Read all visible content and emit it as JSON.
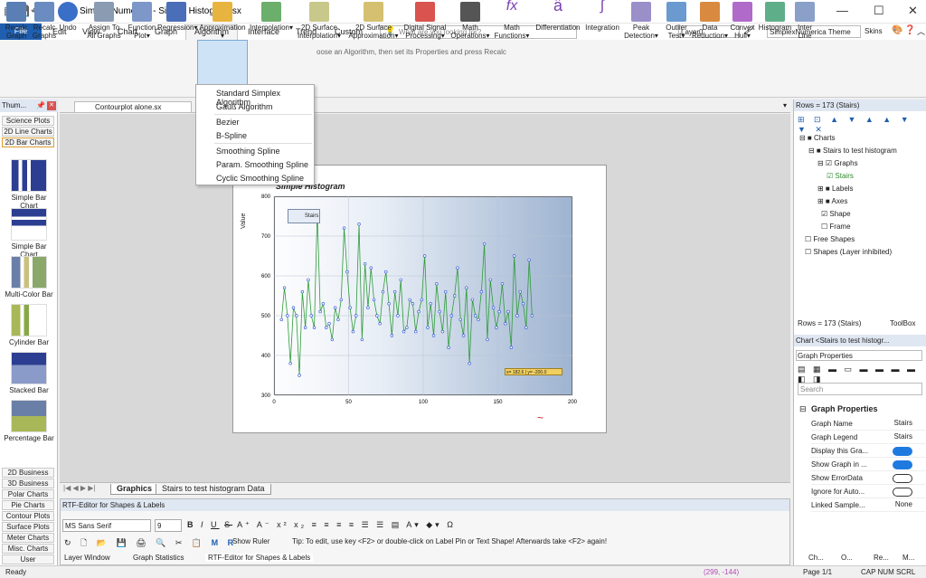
{
  "window": {
    "title": "SimplexNumerica - Simple Histogram.sx"
  },
  "ribbon_tabs": [
    "File",
    "Edit",
    "View",
    "Chart",
    "Graph",
    "Algorithm",
    "Interface",
    "Trend",
    "Custom"
  ],
  "search": {
    "placeholder": "What are you looking for?"
  },
  "layer": {
    "value": "Layer0"
  },
  "theme": {
    "value": "SimplexNumerica Theme",
    "skins_label": "Skins"
  },
  "ribbon_buttons": [
    {
      "label": "Recalc Graph"
    },
    {
      "label": "Recalc Graphs"
    },
    {
      "label": "Undo"
    },
    {
      "label": "Assign To All Graphs"
    },
    {
      "label": "Function Plot▾"
    },
    {
      "label": "Regression▾"
    },
    {
      "label": "Approximation"
    },
    {
      "label": "Interpolation▾"
    },
    {
      "label": "2D Surface Interpolation▾"
    },
    {
      "label": "2D Surface Approximation▾"
    },
    {
      "label": "Digital Signal Processing▾"
    },
    {
      "label": "Math Operations▾"
    },
    {
      "label": "Math Functions▾"
    },
    {
      "label": "Differentiation"
    },
    {
      "label": "Integration"
    },
    {
      "label": "Peak Detection▾"
    },
    {
      "label": "Outlier Test▾"
    },
    {
      "label": "Data Reduction▾"
    },
    {
      "label": "Convex Hull▾"
    },
    {
      "label": "Histogram"
    },
    {
      "label": "Inter Line"
    }
  ],
  "ribbon_hint": "oose an Algorithm, then set its Properties and press Recalc",
  "approx_menu": {
    "items": [
      "Standard Simplex Algorithm",
      "Gauß Algorithm",
      "Bezier",
      "B-Spline",
      "Smoothing Spline",
      "Param. Smoothing Spline",
      "Cyclic Smoothing Spline"
    ]
  },
  "doc_tab": {
    "label": "Contourplot alone.sx"
  },
  "left_panel": {
    "title": "Thum...",
    "categories_top": [
      "Science Plots",
      "2D Line Charts",
      "2D Bar Charts"
    ],
    "thumbs": [
      "Simple Bar Chart",
      "Simple Bar Chart",
      "Multi-Color Bar",
      "Cylinder Bar",
      "Stacked Bar",
      "Percentage Bar"
    ],
    "categories_bottom": [
      "2D Business",
      "3D Business",
      "Polar Charts",
      "Pie Charts",
      "Contour Plots",
      "Surface Plots",
      "Meter Charts",
      "Misc. Charts",
      "User Evaluations"
    ]
  },
  "chart": {
    "title": "Simple Histogram",
    "legend": "Stairs",
    "ylabel": "Value",
    "annotation": "x= 182.6 | y= -200.0",
    "x_ticks": [
      "0",
      "50",
      "100",
      "150",
      "200"
    ],
    "y_ticks": [
      "800",
      "700",
      "600",
      "500",
      "400",
      "300"
    ]
  },
  "chart_data": {
    "type": "line",
    "title": "Simple Histogram",
    "ylabel": "Value",
    "xlim": [
      0,
      200
    ],
    "ylim": [
      300,
      800
    ],
    "grid": true,
    "legend": "top-left",
    "series": [
      {
        "name": "Stairs",
        "x": [
          5,
          7,
          9,
          11,
          13,
          15,
          17,
          19,
          21,
          23,
          25,
          27,
          29,
          31,
          33,
          35,
          37,
          39,
          41,
          43,
          45,
          47,
          49,
          51,
          53,
          55,
          57,
          59,
          61,
          63,
          65,
          67,
          69,
          71,
          73,
          75,
          77,
          79,
          81,
          83,
          85,
          87,
          89,
          91,
          93,
          95,
          97,
          99,
          101,
          103,
          105,
          107,
          109,
          111,
          113,
          115,
          117,
          119,
          121,
          123,
          125,
          127,
          129,
          131,
          133,
          135,
          137,
          139,
          141,
          143,
          145,
          147,
          149,
          151,
          153,
          155,
          157,
          159,
          161,
          163,
          165,
          167,
          169,
          171,
          173
        ],
        "y": [
          490,
          570,
          500,
          380,
          520,
          500,
          350,
          560,
          470,
          590,
          500,
          470,
          760,
          510,
          530,
          470,
          480,
          440,
          520,
          490,
          540,
          720,
          610,
          520,
          460,
          500,
          730,
          440,
          630,
          520,
          620,
          540,
          500,
          480,
          560,
          610,
          530,
          450,
          560,
          500,
          590,
          460,
          470,
          540,
          530,
          460,
          510,
          540,
          650,
          470,
          530,
          450,
          580,
          510,
          460,
          560,
          420,
          500,
          550,
          620,
          490,
          450,
          570,
          380,
          540,
          500,
          490,
          560,
          680,
          440,
          590,
          520,
          470,
          510,
          580,
          480,
          510,
          420,
          650,
          500,
          560,
          530,
          470,
          640,
          500
        ]
      }
    ]
  },
  "bottom_tabs": {
    "graphics": "Graphics",
    "data": "Stairs to test histogram Data"
  },
  "rtf": {
    "title": "RTF-Editor for Shapes & Labels",
    "font": "MS Sans Serif",
    "size": "9",
    "ruler": "Show Ruler",
    "tip": "Tip: To edit, use key <F2> or double-click on Label Pin or Text Shape! Afterwards take <F2> again!"
  },
  "bottom_panels": [
    "Layer Window",
    "Graph Statistics",
    "RTF-Editor for Shapes & Labels"
  ],
  "status": {
    "left": "Ready",
    "coords": "(299, -144)",
    "page": "Page 1/1",
    "keys": "CAP NUM SCRL"
  },
  "right_panel": {
    "rows_title": "Rows = 173 (Stairs)",
    "tree": [
      "Charts",
      "Stairs to test histogram",
      "Graphs",
      "Stairs",
      "Labels",
      "Axes",
      "Shape",
      "Frame",
      "Free Shapes",
      "Shapes (Layer inhibited)"
    ],
    "rows_tab": "Rows = 173 (Stairs)",
    "toolbox_tab": "ToolBox",
    "props_title": "Chart <Stairs to test histogr...",
    "props_combo": "Graph Properties",
    "props_search": "Search",
    "section": "Graph Properties",
    "props": [
      {
        "name": "Graph Name",
        "value": "Stairs"
      },
      {
        "name": "Graph Legend",
        "value": "Stairs"
      },
      {
        "name": "Display this Gra...",
        "value": "on"
      },
      {
        "name": "Show Graph in ...",
        "value": "on"
      },
      {
        "name": "Show ErrorData",
        "value": "off"
      },
      {
        "name": "Ignore for Auto...",
        "value": "off"
      },
      {
        "name": "Linked Sample...",
        "value": "None"
      }
    ],
    "bottom_tabs": [
      "Ch...",
      "O...",
      "Re...",
      "M..."
    ]
  },
  "colors": {
    "accent": "#1f5fb0",
    "line": "#2e9b3a",
    "marker": "#2a4fd6",
    "plot_grad_end": "#9fb4d1"
  }
}
